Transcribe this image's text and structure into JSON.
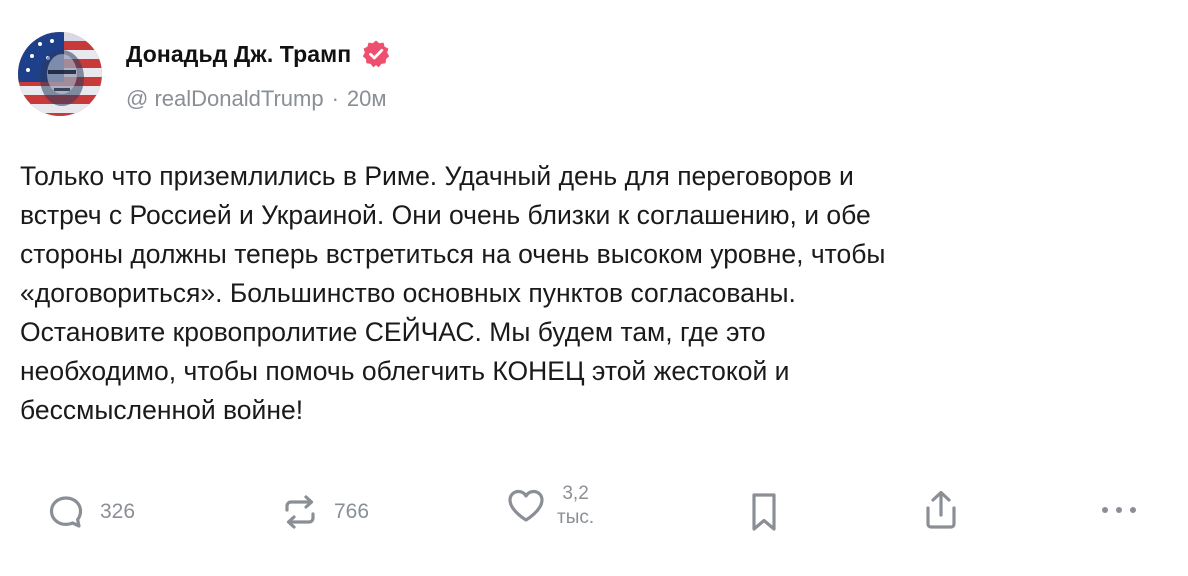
{
  "author": {
    "display_name": "Донадьд Дж. Трамп",
    "handle": "@ realDonaldTrump",
    "separator": "·",
    "time_ago": "20м",
    "avatar_icon": "avatar-image",
    "verified_icon": "verified-badge-icon",
    "verified_color": "#ef4f6f"
  },
  "post": {
    "text": "Только что приземлились в Риме. Удачный день для переговоров и\nвстреч с Россией и Украиной. Они очень близки к соглашению, и обе\nстороны должны теперь встретиться на очень высоком уровне, чтобы\n«договориться». Большинство основных пунктов согласованы.\nОстановите кровопролитие СЕЙЧАС. Мы будем там, где это\nнеобходимо, чтобы помочь облегчить КОНЕЦ этой жестокой и\nбессмысленной войне!"
  },
  "actions": {
    "replies": {
      "icon": "reply-icon",
      "count": "326"
    },
    "reposts": {
      "icon": "repost-icon",
      "count": "766"
    },
    "likes": {
      "icon": "heart-icon",
      "count_line1": "3,2",
      "count_line2": "тыс."
    },
    "bookmark": {
      "icon": "bookmark-icon"
    },
    "share": {
      "icon": "share-icon"
    },
    "more": {
      "icon": "more-icon"
    }
  },
  "colors": {
    "text": "#1a1a1a",
    "muted": "#8a8f96",
    "accent": "#ef4f6f"
  }
}
